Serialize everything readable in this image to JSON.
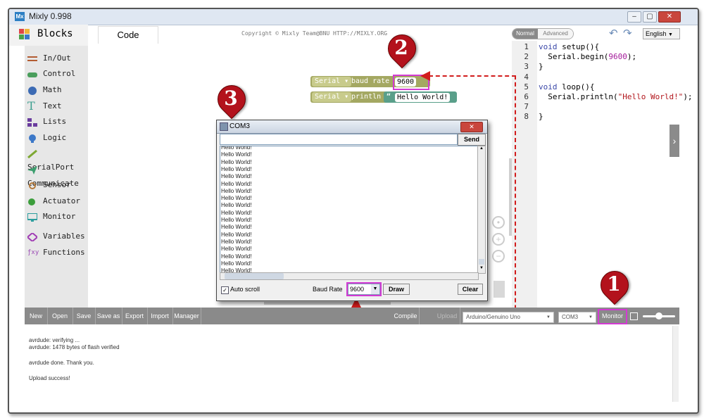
{
  "window": {
    "title": "Mixly 0.998",
    "icon_text": "Mx"
  },
  "header": {
    "blocks_title": "Blocks",
    "code_tab": "Code",
    "copyright": "Copyright © Mixly Team@BNU HTTP://MIXLY.ORG",
    "mode_normal": "Normal",
    "mode_advanced": "Advanced",
    "language": "English"
  },
  "sidebar": {
    "items": [
      {
        "label": "In/Out",
        "icon": "inout-icon",
        "color": "#b35c32"
      },
      {
        "label": "Control",
        "icon": "gamepad-icon",
        "color": "#4a9e5c"
      },
      {
        "label": "Math",
        "icon": "globe-icon",
        "color": "#3c6bb4"
      },
      {
        "label": "Text",
        "icon": "text-icon",
        "color": "#3a9e8e"
      },
      {
        "label": "Lists",
        "icon": "lists-icon",
        "color": "#6a3c9e"
      },
      {
        "label": "Logic",
        "icon": "bulb-icon",
        "color": "#3c78c8"
      },
      {
        "label": "SerialPort",
        "icon": "pen-icon",
        "color": "#7ea833"
      },
      {
        "label": "Communicate",
        "icon": "plane-icon",
        "color": "#3c9e6e"
      },
      {
        "label": "Sensor",
        "icon": "sensor-icon",
        "color": "#b47a3c"
      },
      {
        "label": "Actuator",
        "icon": "actuator-icon",
        "color": "#3c9e3c"
      },
      {
        "label": "Monitor",
        "icon": "monitor-icon",
        "color": "#2c9e9e"
      },
      {
        "label": "Variables",
        "icon": "variables-icon",
        "color": "#a03cb4"
      },
      {
        "label": "Functions",
        "icon": "functions-icon",
        "color": "#9b4ab5"
      }
    ]
  },
  "blocks": {
    "serial1_name": "Serial",
    "serial1_label": "baud rate",
    "serial1_value": "9600",
    "serial2_name": "Serial",
    "serial2_label": "println",
    "serial2_string": "Hello World!"
  },
  "annotations": {
    "one": "1",
    "two": "2",
    "three": "3"
  },
  "code": {
    "lines": [
      {
        "num": "1",
        "text": "void setup(){"
      },
      {
        "num": "2",
        "text": "  Serial.begin(9600);"
      },
      {
        "num": "3",
        "text": "}"
      },
      {
        "num": "4",
        "text": ""
      },
      {
        "num": "5",
        "text": "void loop(){"
      },
      {
        "num": "6",
        "text": "  Serial.println(\"Hello World!\");"
      },
      {
        "num": "7",
        "text": ""
      },
      {
        "num": "8",
        "text": "}"
      }
    ]
  },
  "com_window": {
    "title": "COM3",
    "send_label": "Send",
    "output_line": "Hello World!",
    "output_count": 19,
    "auto_scroll_label": "Auto scroll",
    "auto_scroll_checked": true,
    "baud_rate_label": "Baud Rate",
    "baud_rate_value": "9600",
    "draw_label": "Draw",
    "clear_label": "Clear"
  },
  "bottom_bar": {
    "buttons": [
      "New",
      "Open",
      "Save",
      "Save as",
      "Export",
      "Import",
      "Manager"
    ],
    "compile_label": "Compile",
    "upload_label": "Upload",
    "board": "Arduino/Genuino Uno",
    "port": "COM3",
    "monitor_label": "Monitor"
  },
  "console": {
    "lines": [
      "avrdude: verifying ...",
      "avrdude: 1478 bytes of flash verified",
      "",
      "avrdude done.  Thank you.",
      "",
      "Upload success!"
    ]
  },
  "colors": {
    "highlight": "#d33ad3",
    "annotation_red": "#b3121c",
    "arrow_red": "#d21c1c",
    "serial_block": "#a4a862",
    "text_block": "#5a9f8a"
  }
}
